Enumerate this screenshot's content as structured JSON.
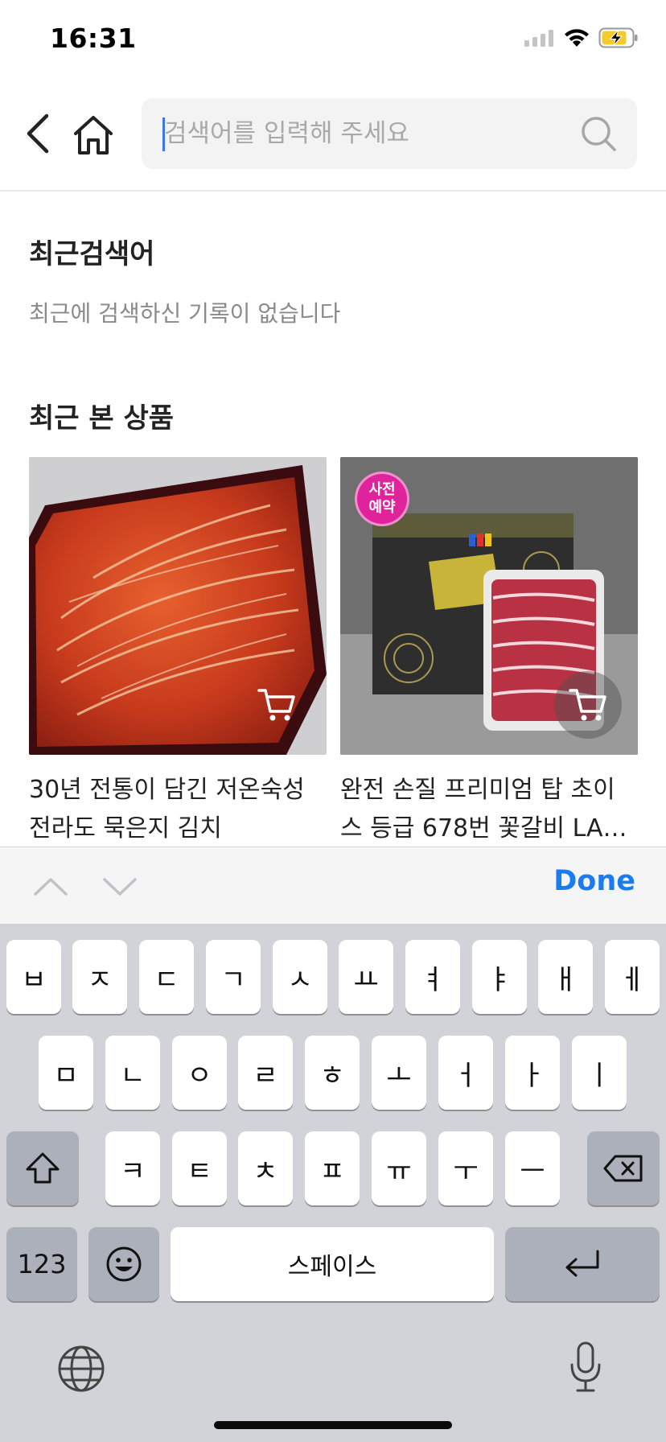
{
  "status_bar": {
    "time": "16:31",
    "battery_color": "#f4cc2a"
  },
  "header": {
    "back_icon": "chevron-left-icon",
    "home_icon": "home-icon",
    "search": {
      "placeholder": "검색어를 입력해 주세요",
      "value": ""
    },
    "search_icon": "search-icon"
  },
  "recent_searches": {
    "title": "최근검색어",
    "empty_message": "최근에 검색하신 기록이 없습니다"
  },
  "recently_viewed": {
    "title": "최근 본 상품",
    "items": [
      {
        "name_line1": "30년 전통이 담긴 저온숙성",
        "name_line2": "전라도 묵은지 김치",
        "badge": null
      },
      {
        "name_line1": "완전 손질 프리미엄 탑 초이",
        "name_line2": "스 등급 678번 꽃갈비 LA…",
        "badge_line1": "사전",
        "badge_line2": "예약",
        "badge_color": "#e0239a"
      }
    ]
  },
  "keyboard_toolbar": {
    "done": "Done",
    "done_color": "#1a7cf0"
  },
  "keyboard": {
    "row1": [
      "ㅂ",
      "ㅈ",
      "ㄷ",
      "ㄱ",
      "ㅅ",
      "ㅛ",
      "ㅕ",
      "ㅑ",
      "ㅐ",
      "ㅔ"
    ],
    "row2": [
      "ㅁ",
      "ㄴ",
      "ㅇ",
      "ㄹ",
      "ㅎ",
      "ㅗ",
      "ㅓ",
      "ㅏ",
      "ㅣ"
    ],
    "row3": [
      "ㅋ",
      "ㅌ",
      "ㅊ",
      "ㅍ",
      "ㅠ",
      "ㅜ",
      "ㅡ"
    ],
    "numbers_key": "123",
    "space_key": "스페이스"
  }
}
